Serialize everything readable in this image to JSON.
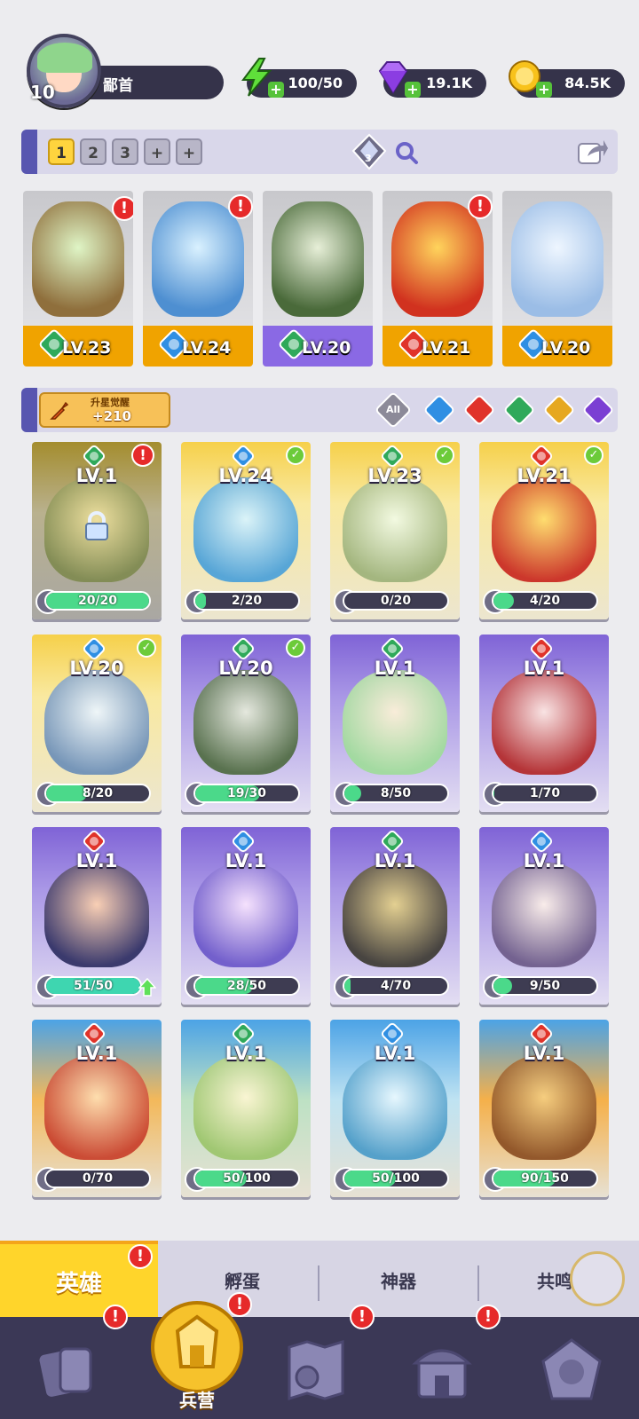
{
  "player": {
    "level": "10",
    "name": "鄙首"
  },
  "resources": {
    "energy": {
      "value": "100/50",
      "icon": "lightning-icon"
    },
    "gems": {
      "value": "19.1K",
      "icon": "gem-icon"
    },
    "coins": {
      "value": "84.5K",
      "icon": "coin-icon"
    }
  },
  "team_tabs": [
    "1",
    "2",
    "3",
    "+",
    "+"
  ],
  "team_filter_count": "3",
  "lineup": [
    {
      "level": "LV.23",
      "element": "wind"
    },
    {
      "level": "LV.24",
      "element": "water"
    },
    {
      "level": "LV.20",
      "element": "wind"
    },
    {
      "level": "LV.21",
      "element": "fire"
    },
    {
      "level": "LV.20",
      "element": "water"
    }
  ],
  "upgrade": {
    "label": "升星觉醒",
    "value": "+210"
  },
  "element_filters": {
    "all": "All"
  },
  "heroes": [
    {
      "level": "LV.1",
      "element": "wind",
      "progress": "20/20",
      "fill": 1.0,
      "locked": true,
      "alert": true
    },
    {
      "level": "LV.24",
      "element": "water",
      "progress": "2/20",
      "fill": 0.1,
      "checked": true
    },
    {
      "level": "LV.23",
      "element": "wind",
      "progress": "0/20",
      "fill": 0.0,
      "checked": true
    },
    {
      "level": "LV.21",
      "element": "fire",
      "progress": "4/20",
      "fill": 0.2,
      "checked": true
    },
    {
      "level": "LV.20",
      "element": "water",
      "progress": "8/20",
      "fill": 0.4,
      "checked": true
    },
    {
      "level": "LV.20",
      "element": "wind",
      "progress": "19/30",
      "fill": 0.63,
      "checked": true
    },
    {
      "level": "LV.1",
      "element": "wind",
      "progress": "8/50",
      "fill": 0.16
    },
    {
      "level": "LV.1",
      "element": "fire",
      "progress": "1/70",
      "fill": 0.01
    },
    {
      "level": "LV.1",
      "element": "fire",
      "progress": "51/50",
      "fill": 1.0,
      "upgrade_ready": true
    },
    {
      "level": "LV.1",
      "element": "water",
      "progress": "28/50",
      "fill": 0.56
    },
    {
      "level": "LV.1",
      "element": "wind",
      "progress": "4/70",
      "fill": 0.06
    },
    {
      "level": "LV.1",
      "element": "water",
      "progress": "9/50",
      "fill": 0.18
    },
    {
      "level": "LV.1",
      "element": "fire",
      "progress": "0/70",
      "fill": 0.0
    },
    {
      "level": "LV.1",
      "element": "wind",
      "progress": "50/100",
      "fill": 0.5
    },
    {
      "level": "LV.1",
      "element": "water",
      "progress": "50/100",
      "fill": 0.5
    },
    {
      "level": "LV.1",
      "element": "fire",
      "progress": "90/150",
      "fill": 0.6
    }
  ],
  "bottom_tabs": {
    "heroes": "英雄",
    "eggs": "孵蛋",
    "artifacts": "神器",
    "resonance": "共鸣"
  },
  "navbar": {
    "barracks": "兵营"
  },
  "colors": {
    "fire": "#e0332a",
    "water": "#2f8fe3",
    "wind": "#2fa95a",
    "light": "#e6a820",
    "dark": "#7b3fd3",
    "accent": "#ffd52b",
    "navbar": "#3b3856"
  }
}
